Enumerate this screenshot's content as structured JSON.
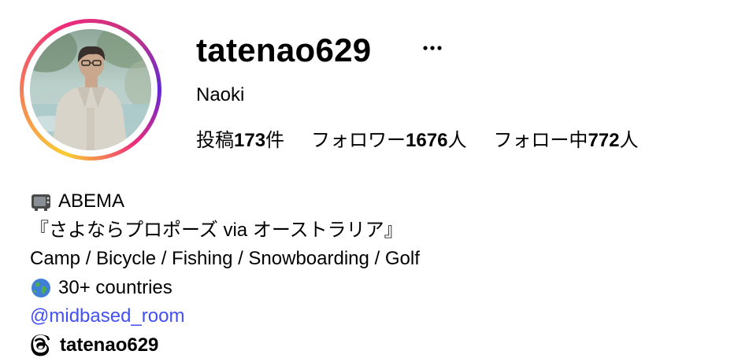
{
  "profile": {
    "username": "tatenao629",
    "full_name": "Naoki",
    "more_icon": "more-horizontal-icon"
  },
  "stats": [
    {
      "label": "投稿",
      "value": "173",
      "unit": "件"
    },
    {
      "label": "フォロワー",
      "value": "1676",
      "unit": "人"
    },
    {
      "label": "フォロー中",
      "value": "772",
      "unit": "人"
    }
  ],
  "bio": {
    "line1_icon": "tv-icon",
    "line1": "ABEMA",
    "line2": "『さよならプロポーズ via オーストラリア』",
    "line3": "Camp / Bicycle / Fishing / Snowboarding / Golf",
    "line4_icon": "globe-icon",
    "line4": "30+ countries",
    "link": "@midbased_room"
  },
  "threads": {
    "icon": "threads-icon",
    "handle": "tatenao629"
  },
  "colors": {
    "link": "#4150f7",
    "text": "#000000",
    "background": "#ffffff"
  }
}
